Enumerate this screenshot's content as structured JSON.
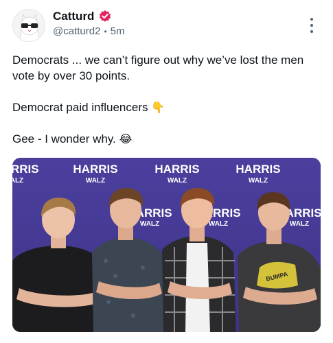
{
  "author": {
    "name": "Catturd",
    "handle": "@catturd2",
    "time": "5m"
  },
  "post": {
    "line1": "Democrats ... we can’t figure out why we’ve lost the men vote by over 30 points.",
    "line2": "Democrat paid influencers",
    "line2_emoji": "👇",
    "line3": "Gee - I wonder why.",
    "line3_emoji": "😂"
  },
  "image": {
    "backdrop_text_main": "HARRIS",
    "backdrop_text_sub": "WALZ",
    "shirt_text": "BUMPA"
  },
  "colors": {
    "verified": "#e0245e",
    "backdrop": "#4a3f9a",
    "secondary_text": "#536471"
  },
  "icons": {
    "verified": "verified-badge-icon",
    "more": "more-vertical-icon"
  }
}
